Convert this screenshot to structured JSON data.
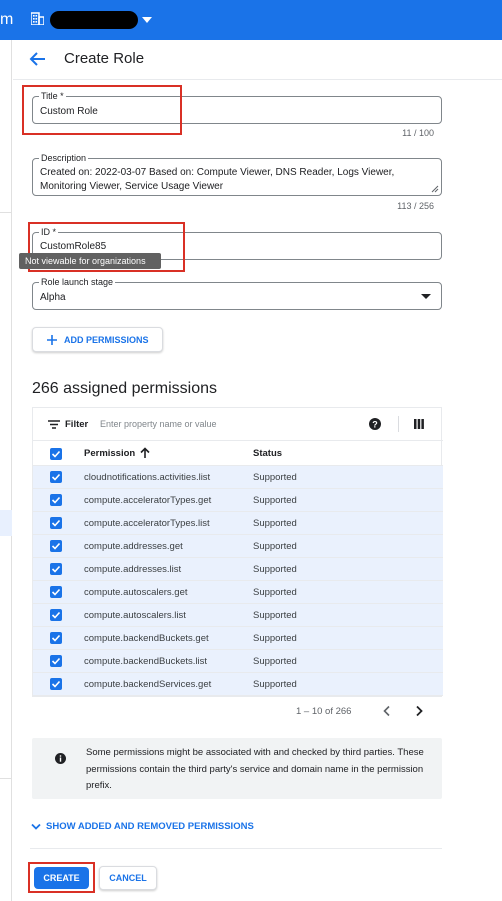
{
  "topbar": {
    "app_letter": "m",
    "project_icon": "org-grid-icon"
  },
  "header": {
    "title": "Create Role"
  },
  "form": {
    "title_label": "Title *",
    "title_value": "Custom Role",
    "title_counter": "11 / 100",
    "description_label": "Description",
    "description_value": "Created on: 2022-03-07 Based on: Compute Viewer, DNS Reader, Logs Viewer, Monitoring Viewer, Service Usage Viewer",
    "description_counter": "113 / 256",
    "id_label": "ID *",
    "id_value": "CustomRole85",
    "tooltip": "Not viewable for organizations",
    "stage_label": "Role launch stage",
    "stage_value": "Alpha",
    "add_permissions": "ADD PERMISSIONS"
  },
  "permissions": {
    "heading": "266 assigned permissions",
    "filter_label": "Filter",
    "filter_placeholder": "Enter property name or value",
    "col_permission": "Permission",
    "col_status": "Status",
    "rows": [
      {
        "permission": "cloudnotifications.activities.list",
        "status": "Supported"
      },
      {
        "permission": "compute.acceleratorTypes.get",
        "status": "Supported"
      },
      {
        "permission": "compute.acceleratorTypes.list",
        "status": "Supported"
      },
      {
        "permission": "compute.addresses.get",
        "status": "Supported"
      },
      {
        "permission": "compute.addresses.list",
        "status": "Supported"
      },
      {
        "permission": "compute.autoscalers.get",
        "status": "Supported"
      },
      {
        "permission": "compute.autoscalers.list",
        "status": "Supported"
      },
      {
        "permission": "compute.backendBuckets.get",
        "status": "Supported"
      },
      {
        "permission": "compute.backendBuckets.list",
        "status": "Supported"
      },
      {
        "permission": "compute.backendServices.get",
        "status": "Supported"
      }
    ],
    "pagination": "1 – 10 of 266"
  },
  "info": {
    "text": "Some permissions might be associated with and checked by third parties. These permissions contain the third party's service and domain name in the permission prefix."
  },
  "show_added_removed": "SHOW ADDED AND REMOVED PERMISSIONS",
  "actions": {
    "create": "CREATE",
    "cancel": "CANCEL"
  },
  "colors": {
    "accent": "#1a73e8",
    "highlight": "#d93025",
    "row_selected": "#eaf1fd"
  }
}
